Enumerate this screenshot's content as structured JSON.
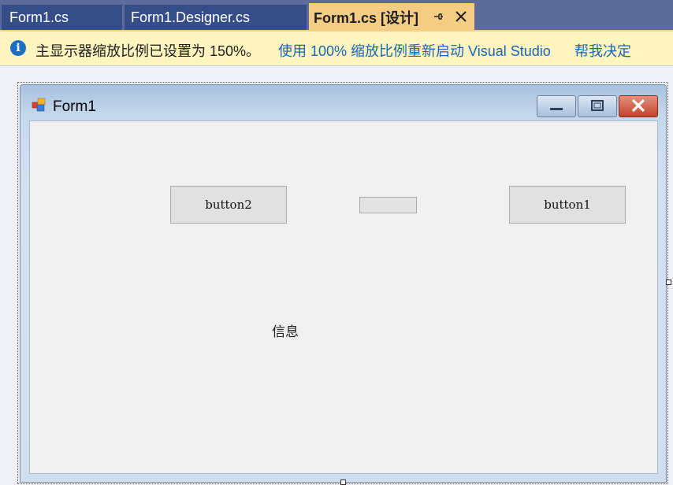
{
  "tabs": [
    {
      "label": "Form1.cs",
      "active": false
    },
    {
      "label": "Form1.Designer.cs",
      "active": false
    },
    {
      "label": "Form1.cs [设计]",
      "active": true
    }
  ],
  "infobar": {
    "icon": "info-icon",
    "icon_glyph": "i",
    "message": "主显示器缩放比例已设置为 150%。",
    "link_restart": "使用 100% 缩放比例重新启动 Visual Studio",
    "link_decide": "帮我决定"
  },
  "form": {
    "title": "Form1",
    "controls": {
      "button2_label": "button2",
      "button1_label": "button1",
      "textbox_value": "",
      "label_text": "信息"
    }
  },
  "colors": {
    "tab_strip": "#5d6b99",
    "active_tab": "#f5cc84",
    "infobar": "#fdf4bf",
    "link": "#1766b5"
  }
}
